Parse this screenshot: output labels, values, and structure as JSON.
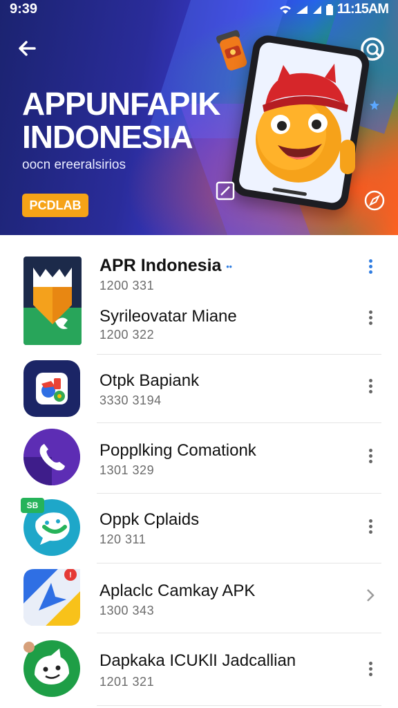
{
  "status": {
    "left_time": "9:39",
    "right_time": "11:15AM"
  },
  "hero": {
    "title_line1": "APPUNFAPIK",
    "title_line2": "INDONESIA",
    "subtitle": "oocn ereeralsirios",
    "badge": "PCDLAB",
    "colors": {
      "badge": "#f6a317",
      "bg_start": "#1b2370",
      "bg_end": "#ff6a22"
    }
  },
  "apps": [
    {
      "title": "APR Indonesia",
      "title_mark": "••",
      "sub": "1200 331",
      "icon": "apk-shield-icon",
      "action": "more-vert-icon-blue"
    },
    {
      "title": "Syrileovatar Miane",
      "sub": "1200 322",
      "icon": "apk-shield-icon",
      "action": "more-vert-icon"
    },
    {
      "title": "Otpk Bapiank",
      "sub": "3330 3194",
      "icon": "google-style-icon",
      "action": "more-vert-icon"
    },
    {
      "title": "Popplking Comationk",
      "sub": "1301 329",
      "icon": "phone-call-icon",
      "action": "more-vert-icon"
    },
    {
      "title": "Oppk Cplaids",
      "sub": "120 311",
      "icon": "chat-bubble-icon",
      "badge": "SB",
      "action": "more-vert-icon"
    },
    {
      "title": "Aplaclc Camkay APK",
      "sub": "1300 343",
      "icon": "navigation-map-icon",
      "action": "chevron-right-icon"
    },
    {
      "title": "Dapkaka ICUKlI Jadcallian",
      "sub": "1201 321",
      "icon": "android-face-icon",
      "action": "more-vert-icon"
    }
  ]
}
